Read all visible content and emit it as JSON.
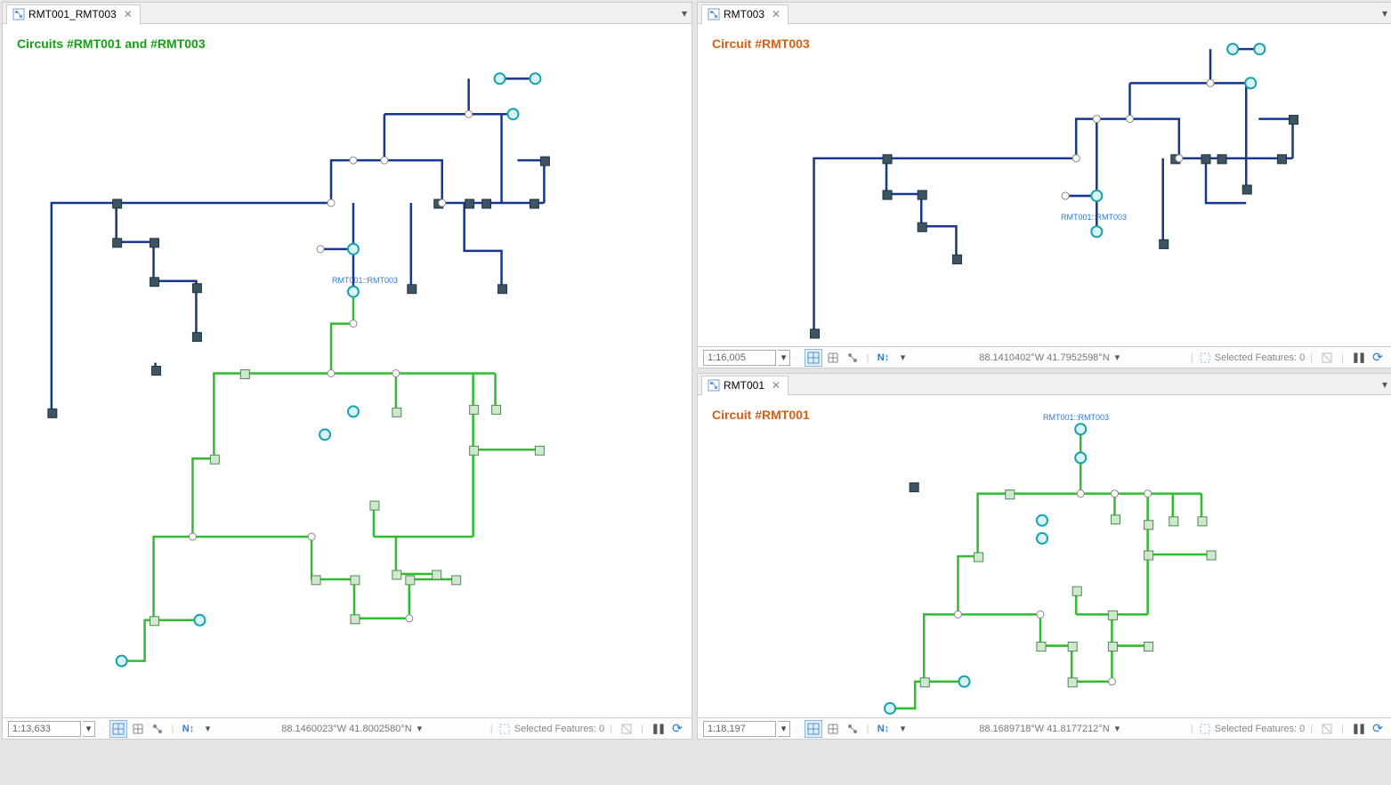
{
  "tabs": {
    "top_left": {
      "label": "RMT003"
    },
    "bottom_left": {
      "label": "RMT001"
    },
    "right": {
      "label": "RMT001_RMT003"
    }
  },
  "titles": {
    "top_left": "Circuit #RMT003",
    "bottom_left": "Circuit #RMT001",
    "right": "Circuits #RMT001 and #RMT003"
  },
  "labels": {
    "connector": "RMT001::RMT003"
  },
  "status": {
    "top_left": {
      "scale": "1:16,005",
      "coords": "88.1410402°W 41.7952598°N",
      "selected": "Selected Features: 0"
    },
    "bottom_left": {
      "scale": "1:18,197",
      "coords": "88.1689718°W 41.8177212°N",
      "selected": "Selected Features: 0"
    },
    "right": {
      "scale": "1:13,633",
      "coords": "88.1460023°W 41.8002580°N",
      "selected": "Selected Features: 0"
    }
  },
  "colors": {
    "blue": "#0a2da4",
    "green": "#2fbc2f",
    "cyan": "#1aa0b0",
    "node_dark": "#2f4656",
    "node_lt": "#b7deb7",
    "white": "#ffffff"
  }
}
